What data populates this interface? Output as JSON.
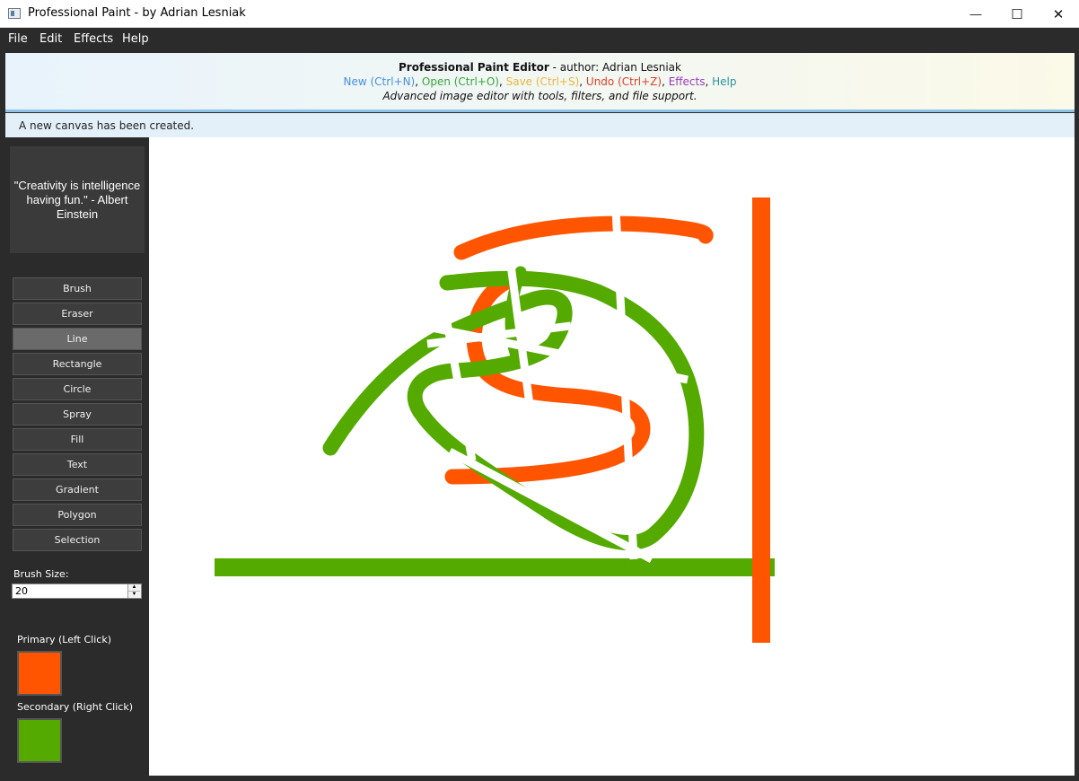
{
  "window": {
    "title": "Professional Paint - by Adrian Lesniak",
    "minimize_glyph": "—",
    "maximize_glyph": "☐",
    "close_glyph": "✕"
  },
  "menu": {
    "items": [
      {
        "label": "File"
      },
      {
        "label": "Edit"
      },
      {
        "label": "Effects"
      },
      {
        "label": "Help"
      }
    ]
  },
  "banner": {
    "title": "Professional Paint Editor",
    "title_suffix": " - author: Adrian Lesniak",
    "shortcuts": [
      {
        "label": "New (Ctrl+N)",
        "color": "#4a8fe0"
      },
      {
        "label": "Open (Ctrl+O)",
        "color": "#3aa63a"
      },
      {
        "label": "Save (Ctrl+S)",
        "color": "#e8b83a"
      },
      {
        "label": "Undo (Ctrl+Z)",
        "color": "#e0402a"
      },
      {
        "label": "Effects",
        "color": "#9a3ac0"
      },
      {
        "label": "Help",
        "color": "#2a8fa0"
      }
    ],
    "separator": ", ",
    "subtitle": "Advanced image editor with tools, filters, and file support."
  },
  "status": {
    "message": "A new canvas has been created."
  },
  "sidebar": {
    "quote": "\"Creativity is intelligence having fun.\" - Albert Einstein",
    "tools": [
      {
        "label": "Brush",
        "active": false
      },
      {
        "label": "Eraser",
        "active": false
      },
      {
        "label": "Line",
        "active": true
      },
      {
        "label": "Rectangle",
        "active": false
      },
      {
        "label": "Circle",
        "active": false
      },
      {
        "label": "Spray",
        "active": false
      },
      {
        "label": "Fill",
        "active": false
      },
      {
        "label": "Text",
        "active": false
      },
      {
        "label": "Gradient",
        "active": false
      },
      {
        "label": "Polygon",
        "active": false
      },
      {
        "label": "Selection",
        "active": false
      }
    ],
    "brush_size_label": "Brush Size:",
    "brush_size_value": "20",
    "spin_up_glyph": "▲",
    "spin_down_glyph": "▼",
    "primary_label": "Primary (Left Click)",
    "secondary_label": "Secondary (Right Click)",
    "primary_color": "#ff5500",
    "secondary_color": "#55aa00"
  }
}
